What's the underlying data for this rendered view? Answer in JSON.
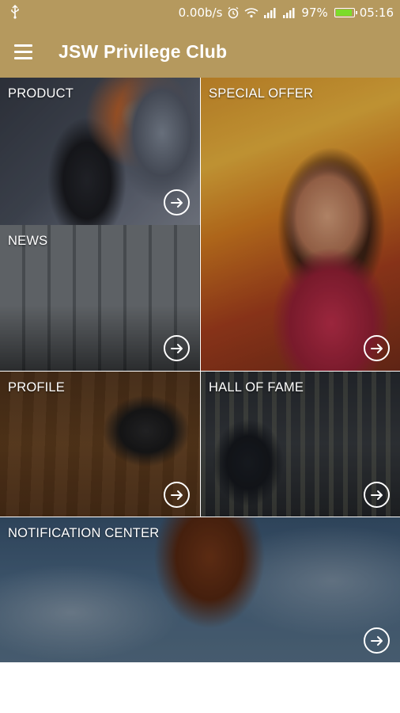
{
  "status_bar": {
    "usb_icon": "usb-icon",
    "network_speed": "0.00b/s",
    "battery_percent": "97%",
    "battery_level": 0.97,
    "time": "05:16"
  },
  "app_bar": {
    "title": "JSW Privilege Club",
    "menu_icon": "hamburger-menu-icon"
  },
  "tiles": [
    {
      "label": "PRODUCT"
    },
    {
      "label": "SPECIAL OFFER"
    },
    {
      "label": "NEWS"
    },
    {
      "label": "PROFILE"
    },
    {
      "label": "HALL OF FAME"
    },
    {
      "label": "NOTIFICATION CENTER"
    }
  ],
  "colors": {
    "app_bar": "#b5995e",
    "battery_fill": "#7bdc2a"
  }
}
